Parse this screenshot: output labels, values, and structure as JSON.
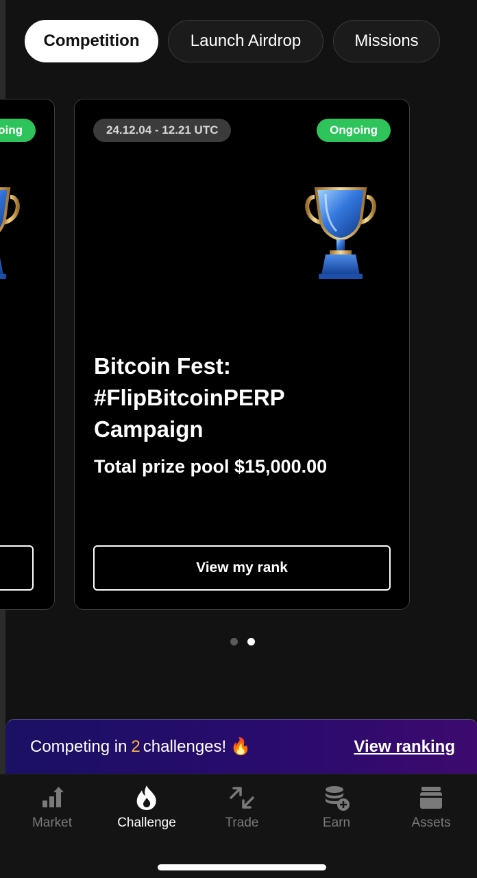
{
  "tabs": [
    {
      "label": "Competition",
      "active": true
    },
    {
      "label": "Launch Airdrop",
      "active": false
    },
    {
      "label": "Missions",
      "active": false
    }
  ],
  "cards": {
    "prev": {
      "status": "Ongoing"
    },
    "main": {
      "date_range": "24.12.04 - 12.21 UTC",
      "status": "Ongoing",
      "title": "Bitcoin Fest:\n#FlipBitcoinPERP\nCampaign",
      "prize": "Total prize pool $15,000.00",
      "button_label": "View my rank"
    }
  },
  "carousel": {
    "count": 2,
    "active_index": 1
  },
  "banner": {
    "text_before": "Competing in",
    "count": "2",
    "text_after": "challenges!",
    "emoji": "🔥",
    "link_label": "View ranking"
  },
  "nav": [
    {
      "label": "Market",
      "icon": "bar-chart-icon",
      "active": false
    },
    {
      "label": "Challenge",
      "icon": "flame-icon",
      "active": true
    },
    {
      "label": "Trade",
      "icon": "swap-arrows-icon",
      "active": false
    },
    {
      "label": "Earn",
      "icon": "coin-stack-plus-icon",
      "active": false
    },
    {
      "label": "Assets",
      "icon": "wallet-icon",
      "active": false
    }
  ],
  "colors": {
    "background": "#121212",
    "status_green": "#2fc45b",
    "banner_accent": "#f5b642",
    "banner_gradient_start": "#1a1064",
    "banner_gradient_end": "#3d0a6e"
  }
}
